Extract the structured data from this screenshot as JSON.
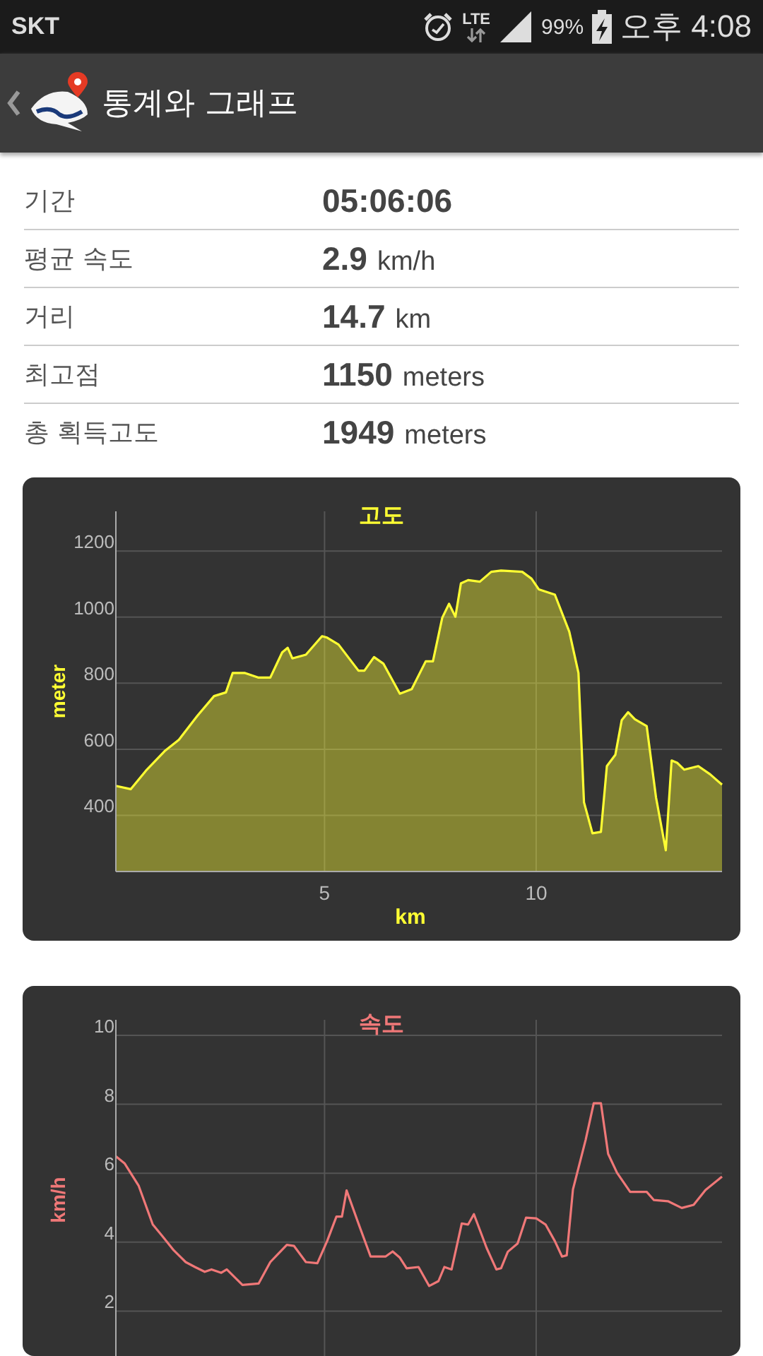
{
  "status_bar": {
    "carrier": "SKT",
    "network": "LTE",
    "battery": "99%",
    "time": "오후 4:08"
  },
  "action_bar": {
    "title": "통계와 그래프"
  },
  "stats": [
    {
      "label": "기간",
      "value": "05:06:06"
    },
    {
      "label": "평균 속도",
      "value": "2.9",
      "unit": "km/h"
    },
    {
      "label": "거리",
      "value": "14.7",
      "unit": "km"
    },
    {
      "label": "최고점",
      "value": "1150",
      "unit": "meters"
    },
    {
      "label": "총 획득고도",
      "value": "1949",
      "unit": "meters"
    }
  ],
  "charts": [
    {
      "chart_data": {
        "type": "area",
        "title": "고도",
        "xlabel": "km",
        "ylabel": "meter",
        "xlim": [
          0.07,
          14.39
        ],
        "ylim": [
          230,
          1320
        ],
        "xticks": [
          5,
          10
        ],
        "yticks": [
          400,
          600,
          800,
          1000,
          1200
        ],
        "x": [
          0.07,
          0.42,
          0.78,
          1.22,
          1.56,
          2.0,
          2.39,
          2.67,
          2.83,
          3.11,
          3.44,
          3.72,
          4.0,
          4.13,
          4.24,
          4.56,
          4.94,
          5.06,
          5.33,
          5.8,
          5.94,
          6.17,
          6.39,
          6.78,
          7.06,
          7.39,
          7.56,
          7.78,
          7.94,
          8.09,
          8.22,
          8.39,
          8.67,
          8.94,
          9.17,
          9.67,
          9.89,
          10.06,
          10.44,
          10.78,
          11.0,
          11.13,
          11.33,
          11.53,
          11.67,
          11.87,
          12.02,
          12.17,
          12.33,
          12.61,
          12.83,
          13.06,
          13.2,
          13.33,
          13.5,
          13.83,
          14.11,
          14.39
        ],
        "grid": true,
        "series": [
          {
            "color": "#ffff33",
            "values": [
              489,
              479,
              535,
              594,
              629,
              702,
              761,
              772,
              831,
              831,
              817,
              817,
              893,
              907,
              875,
              886,
              942,
              938,
              917,
              838,
              838,
              879,
              859,
              768,
              782,
              866,
              866,
              998,
              1040,
              1001,
              1102,
              1112,
              1107,
              1137,
              1141,
              1137,
              1116,
              1084,
              1068,
              956,
              831,
              440,
              346,
              350,
              549,
              583,
              688,
              712,
              691,
              670,
              454,
              294,
              566,
              559,
              538,
              549,
              524,
              493
            ]
          }
        ]
      }
    },
    {
      "chart_data": {
        "type": "line",
        "title": "속도",
        "ylabel": "km/h",
        "xlim": [
          0.07,
          14.39
        ],
        "ylim": [
          0,
          10.45
        ],
        "yticks": [
          2,
          4,
          6,
          8,
          10
        ],
        "x": [
          0.07,
          0.28,
          0.61,
          0.94,
          1.17,
          1.44,
          1.72,
          1.94,
          2.17,
          2.33,
          2.56,
          2.69,
          3.06,
          3.44,
          3.72,
          4.11,
          4.28,
          4.56,
          4.83,
          5.06,
          5.28,
          5.41,
          5.52,
          5.83,
          6.09,
          6.44,
          6.61,
          6.78,
          6.94,
          7.22,
          7.47,
          7.69,
          7.83,
          8.0,
          8.24,
          8.39,
          8.53,
          8.83,
          9.06,
          9.17,
          9.33,
          9.56,
          9.76,
          10.0,
          10.22,
          10.44,
          10.61,
          10.72,
          10.87,
          11.17,
          11.36,
          11.53,
          11.7,
          11.91,
          12.22,
          12.61,
          12.78,
          13.11,
          13.44,
          13.72,
          14.0,
          14.39
        ],
        "grid": true,
        "series": [
          {
            "color": "#f07878",
            "values": [
              6.49,
              6.28,
              5.63,
              4.51,
              4.17,
              3.76,
              3.42,
              3.28,
              3.14,
              3.21,
              3.11,
              3.21,
              2.76,
              2.8,
              3.42,
              3.92,
              3.89,
              3.42,
              3.39,
              4.03,
              4.74,
              4.74,
              5.5,
              4.44,
              3.58,
              3.58,
              3.73,
              3.55,
              3.24,
              3.28,
              2.73,
              2.87,
              3.28,
              3.21,
              4.54,
              4.51,
              4.81,
              3.83,
              3.21,
              3.24,
              3.72,
              3.96,
              4.71,
              4.69,
              4.51,
              4.03,
              3.58,
              3.62,
              5.53,
              6.97,
              8.03,
              8.03,
              6.56,
              6.01,
              5.46,
              5.46,
              5.22,
              5.19,
              4.99,
              5.08,
              5.51,
              5.9
            ]
          }
        ]
      }
    }
  ]
}
